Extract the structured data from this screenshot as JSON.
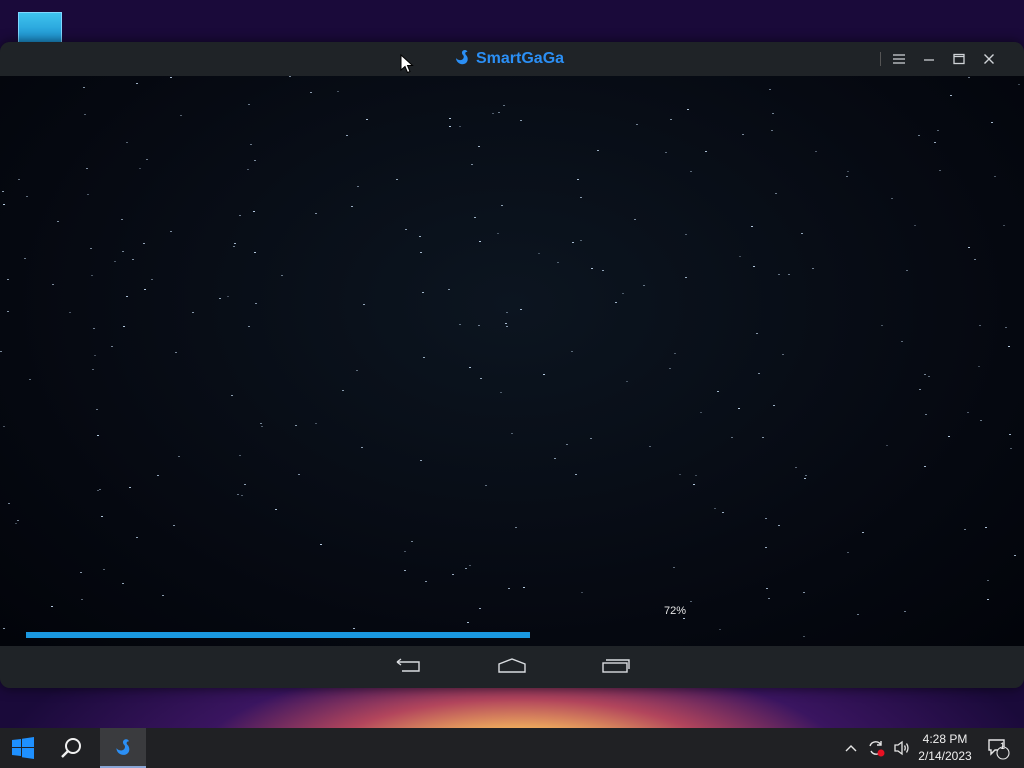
{
  "window": {
    "brand": "SmartGaGa"
  },
  "loading": {
    "percent_label": "72%",
    "progress": 0.72
  },
  "taskbar": {
    "time": "4:28 PM",
    "date": "2/14/2023",
    "notification_count": "1"
  },
  "colors": {
    "accent": "#1a98e0",
    "brand": "#2b8ff5"
  },
  "icons": [
    "desktop-folder-icon",
    "swan-logo-icon",
    "menu-icon",
    "minimize-icon",
    "maximize-icon",
    "close-icon",
    "back-icon",
    "home-icon",
    "recents-icon",
    "start-icon",
    "search-icon",
    "smartgaga-taskbar-icon",
    "chevron-up-icon",
    "sync-icon",
    "volume-icon",
    "notification-icon"
  ]
}
